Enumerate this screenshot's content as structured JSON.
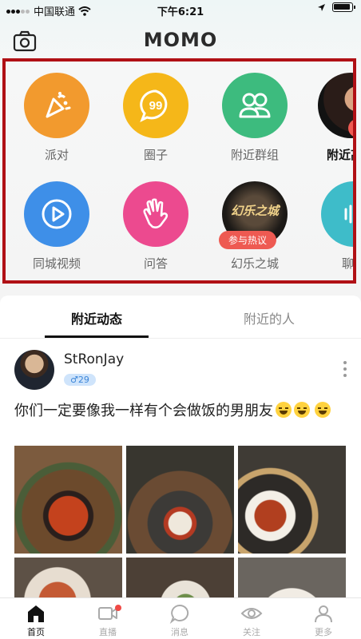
{
  "status": {
    "carrier": "中国联通",
    "time": "下午6:21"
  },
  "header": {
    "title": "MOMO"
  },
  "quick_grid": {
    "row1": [
      {
        "label": "派对",
        "color": "#f29a2e",
        "icon": "party-popper-icon"
      },
      {
        "label": "圈子",
        "color": "#f5b719",
        "icon": "chat-bubble-99-icon"
      },
      {
        "label": "附近群组",
        "color": "#3dbb7e",
        "icon": "group-people-icon"
      },
      {
        "label": "附近高颜",
        "badge": "点",
        "icon": "avatar-photo"
      }
    ],
    "row2": [
      {
        "label": "同城视频",
        "color": "#3e8fe8",
        "icon": "play-icon"
      },
      {
        "label": "问答",
        "color": "#ec4a8f",
        "icon": "waving-hand-icon"
      },
      {
        "label": "幻乐之城",
        "badge": "参与热议",
        "poster_text": "幻乐之城",
        "icon": "show-poster"
      },
      {
        "label": "聊天",
        "color": "#3ebcc9",
        "icon": "voice-wave-icon"
      }
    ]
  },
  "feed": {
    "tabs": [
      {
        "label": "附近动态",
        "active": true
      },
      {
        "label": "附近的人",
        "active": false
      }
    ],
    "post": {
      "username": "StRonJay",
      "age_badge": "♂29",
      "text": "你们一定要像我一样有个会做饭的男朋友"
    }
  },
  "tabbar": [
    {
      "label": "首页",
      "icon": "home-icon",
      "active": true
    },
    {
      "label": "直播",
      "icon": "video-camera-icon",
      "active": false
    },
    {
      "label": "消息",
      "icon": "message-bubble-icon",
      "active": false
    },
    {
      "label": "关注",
      "icon": "eye-icon",
      "active": false
    },
    {
      "label": "更多",
      "icon": "person-icon",
      "active": false
    }
  ]
}
